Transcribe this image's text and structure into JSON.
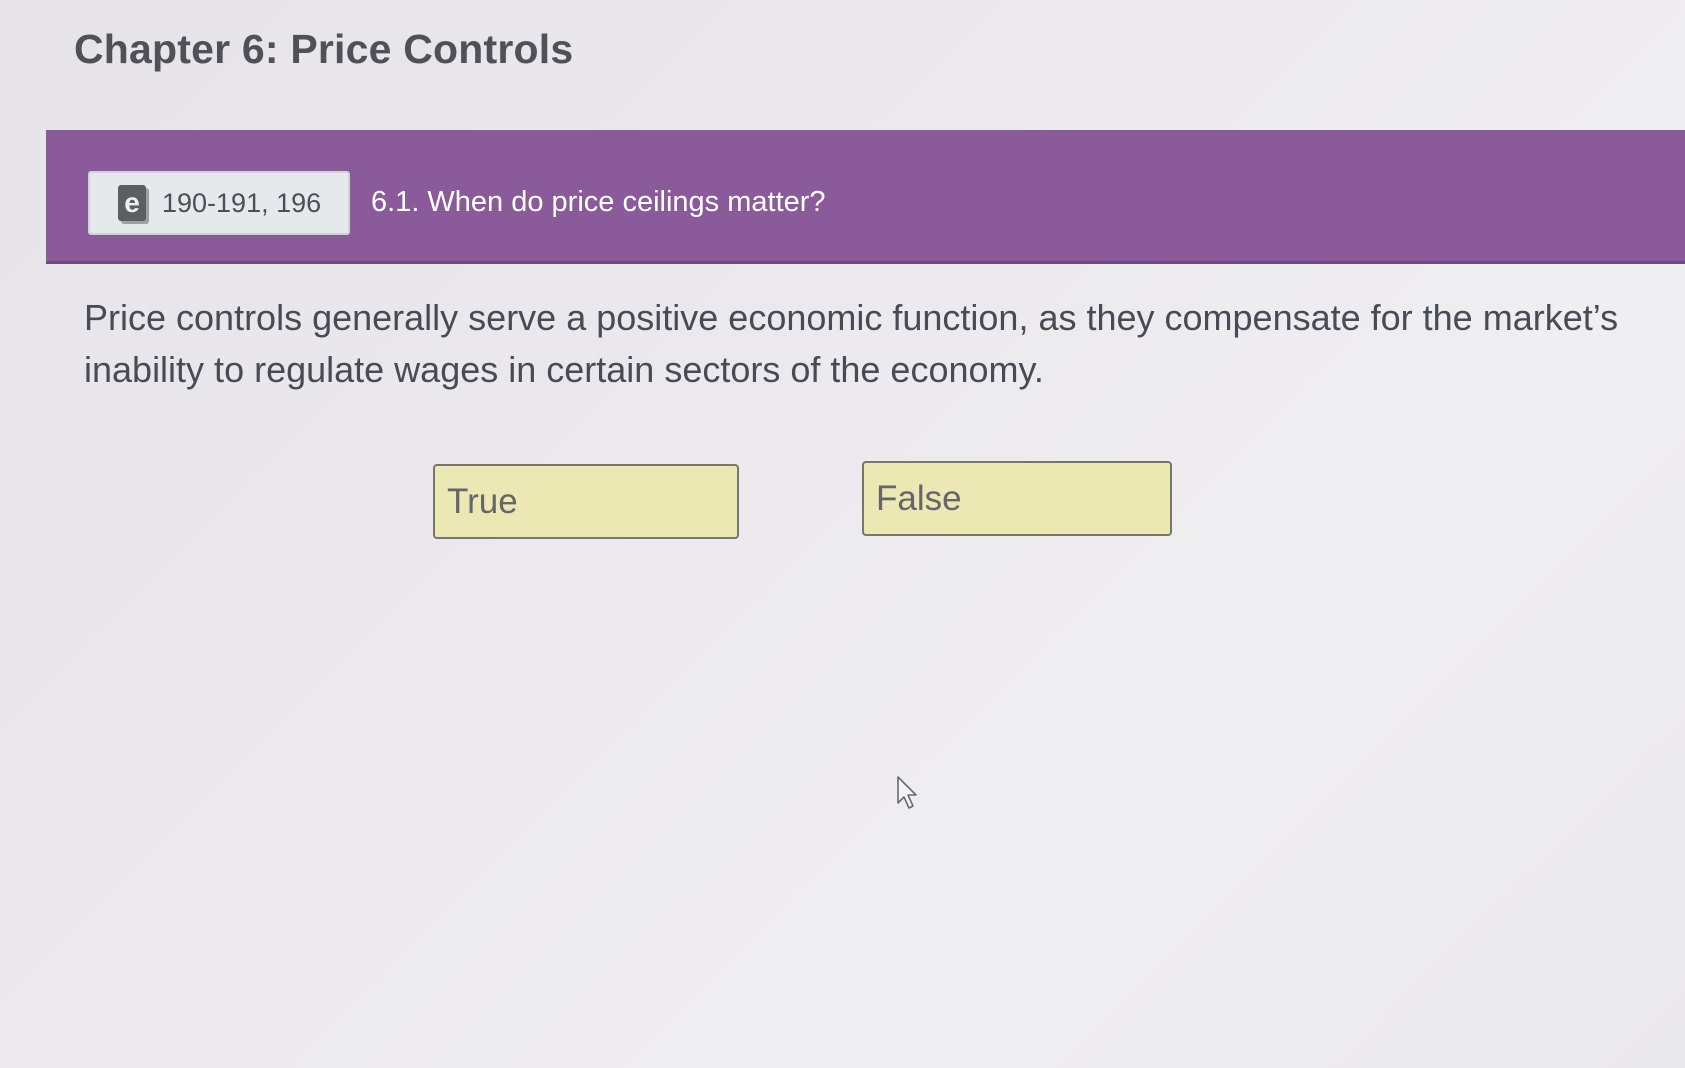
{
  "page": {
    "title": "Chapter 6: Price Controls"
  },
  "banner": {
    "reference_icon": "ebook-icon",
    "reference_icon_glyph": "e",
    "reference_pages": "190-191, 196",
    "question_heading": "6.1. When do price ceilings matter?",
    "background_color": "#8a5a9a"
  },
  "question": {
    "text": "Price controls generally serve a positive economic function, as they compensate for the market’s inability to regulate wages in certain sectors of the economy."
  },
  "answers": {
    "true_label": "True",
    "false_label": "False",
    "button_color": "#ebe8b3"
  },
  "cursor": {
    "icon": "pointer-arrow-icon"
  }
}
